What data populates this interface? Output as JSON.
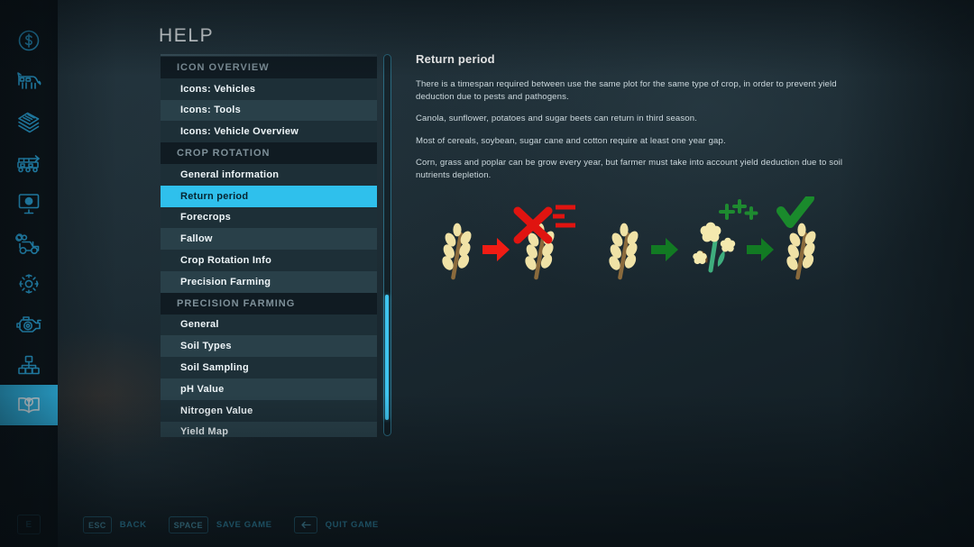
{
  "window": {
    "title": "HELP"
  },
  "colors": {
    "accent": "#2fc0ec",
    "rail_icon": "#2aa9e0",
    "panel_row_dark": "#1d2f37",
    "panel_row_light": "#294049",
    "section_header_bg": "#101b22",
    "section_header_text": "#7e9099",
    "body_text": "#cdd9de",
    "heading_text": "#ffffff",
    "hotkey_text": "#3fb4dd",
    "background": "#1d2c34"
  },
  "rail": {
    "items": [
      {
        "name": "finances-icon",
        "label": "Finances",
        "active": false
      },
      {
        "name": "animals-icon",
        "label": "Animals",
        "active": false
      },
      {
        "name": "contracts-icon",
        "label": "Contracts",
        "active": false
      },
      {
        "name": "production-icon",
        "label": "Production",
        "active": false
      },
      {
        "name": "statistics-icon",
        "label": "Statistics",
        "active": false
      },
      {
        "name": "vehicle-config-icon",
        "label": "Vehicle Configuration",
        "active": false
      },
      {
        "name": "settings-gear-icon",
        "label": "Settings",
        "active": false
      },
      {
        "name": "engine-icon",
        "label": "Engine",
        "active": false
      },
      {
        "name": "production-chain-icon",
        "label": "Production Chain",
        "active": false
      },
      {
        "name": "help-book-icon",
        "label": "Help",
        "active": true
      }
    ],
    "e_key": "E"
  },
  "menu": {
    "rows": [
      {
        "label": "ICON OVERVIEW",
        "type": "section"
      },
      {
        "label": "Icons: Vehicles",
        "type": "item",
        "selected": false
      },
      {
        "label": "Icons: Tools",
        "type": "item",
        "selected": false
      },
      {
        "label": "Icons: Vehicle Overview",
        "type": "item",
        "selected": false
      },
      {
        "label": "CROP ROTATION",
        "type": "section"
      },
      {
        "label": "General information",
        "type": "item",
        "selected": false
      },
      {
        "label": "Return period",
        "type": "item",
        "selected": true
      },
      {
        "label": "Forecrops",
        "type": "item",
        "selected": false
      },
      {
        "label": "Fallow",
        "type": "item",
        "selected": false
      },
      {
        "label": "Crop Rotation Info",
        "type": "item",
        "selected": false
      },
      {
        "label": "Precision Farming",
        "type": "item",
        "selected": false
      },
      {
        "label": "PRECISION FARMING",
        "type": "section"
      },
      {
        "label": "General",
        "type": "item",
        "selected": false
      },
      {
        "label": "Soil Types",
        "type": "item",
        "selected": false
      },
      {
        "label": "Soil Sampling",
        "type": "item",
        "selected": false
      },
      {
        "label": "pH Value",
        "type": "item",
        "selected": false
      },
      {
        "label": "Nitrogen Value",
        "type": "item",
        "selected": false
      },
      {
        "label": "Yield Map",
        "type": "item",
        "selected": false
      }
    ],
    "scrollbar": {
      "thumb_top_pct": 63,
      "thumb_height_pct": 33
    }
  },
  "article": {
    "heading": "Return period",
    "paragraphs": [
      "There is a timespan required between use the same plot for the same type of crop, in order to prevent yield deduction due to pests and pathogens.",
      "Canola, sunflower, potatoes and sugar beets can return in third season.",
      "Most of cereals, soybean, sugar cane and cotton require at least one year gap.",
      "Corn, grass and poplar can be grow every year, but farmer must take into account yield deduction due to soil nutrients depletion."
    ],
    "illustration": {
      "description": "Crop rotation diagram",
      "sequence_bad": {
        "from": "wheat-icon",
        "arrow": "red-arrow-icon",
        "to": "wheat-icon",
        "marks": [
          "red-cross-icon",
          "red-minus-icon",
          "red-minus-icon"
        ]
      },
      "sequence_good": {
        "from": "wheat-icon",
        "arrow1": "green-arrow-icon",
        "middle": "canola-flower-icon",
        "plus_marks": [
          "green-plus-icon",
          "green-plus-icon",
          "green-plus-icon"
        ],
        "arrow2": "green-arrow-icon",
        "to": "wheat-icon",
        "marks": [
          "green-check-icon"
        ]
      }
    }
  },
  "hotkeys": [
    {
      "key": "ESC",
      "label": "BACK",
      "icon": null
    },
    {
      "key": "SPACE",
      "label": "SAVE GAME",
      "icon": null
    },
    {
      "key": "",
      "label": "QUIT GAME",
      "icon": "backspace-arrow-icon"
    }
  ]
}
